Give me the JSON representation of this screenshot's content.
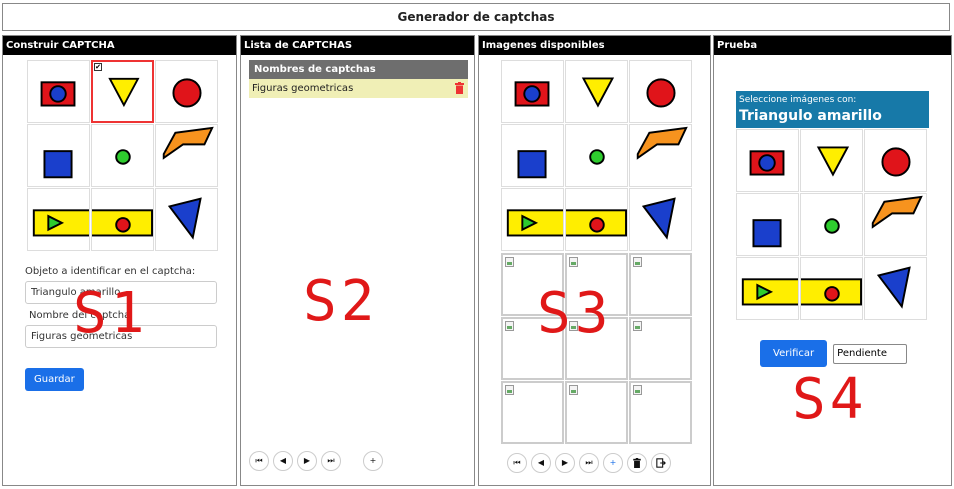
{
  "header": {
    "title": "Generador de captchas"
  },
  "panels": {
    "build": {
      "title": "Construir CAPTCHA",
      "object_label": "Objeto a identificar en el captcha:",
      "object_value": "Triangulo amarillo",
      "name_label": "Nombre del captcha",
      "name_value": "Figuras geometricas",
      "save_label": "Guardar",
      "selected_cell": 2,
      "overlay": "S1"
    },
    "list": {
      "title": "Lista de CAPTCHAS",
      "column_header": "Nombres de captchas",
      "items": [
        "Figuras geometricas"
      ],
      "overlay": "S2",
      "pager": [
        "⏮",
        "◀",
        "▶",
        "⏭",
        "+"
      ]
    },
    "images": {
      "title": "Imagenes disponibles",
      "overlay": "S3",
      "pager": [
        "⏮",
        "◀",
        "▶",
        "⏭",
        "+",
        "trash",
        "export"
      ]
    },
    "test": {
      "title": "Prueba",
      "instruction": "Seleccione imágenes con:",
      "target": "Triangulo amarillo",
      "verify_label": "Verificar",
      "status_value": "Pendiente",
      "overlay": "S4"
    }
  },
  "images": {
    "cells": [
      "red-rectangle-blue-circle",
      "yellow-triangle",
      "red-circle",
      "blue-square",
      "green-circle",
      "orange-polygon",
      "yellow-bar-left",
      "yellow-bar-middle",
      "blue-triangle"
    ],
    "broken_count": 9
  },
  "colors": {
    "header_bg": "#000000",
    "accent": "#1a6fe8",
    "test_banner": "#1779a8",
    "list_item_bg": "#f0efb6",
    "overlay_text": "#e01818"
  }
}
